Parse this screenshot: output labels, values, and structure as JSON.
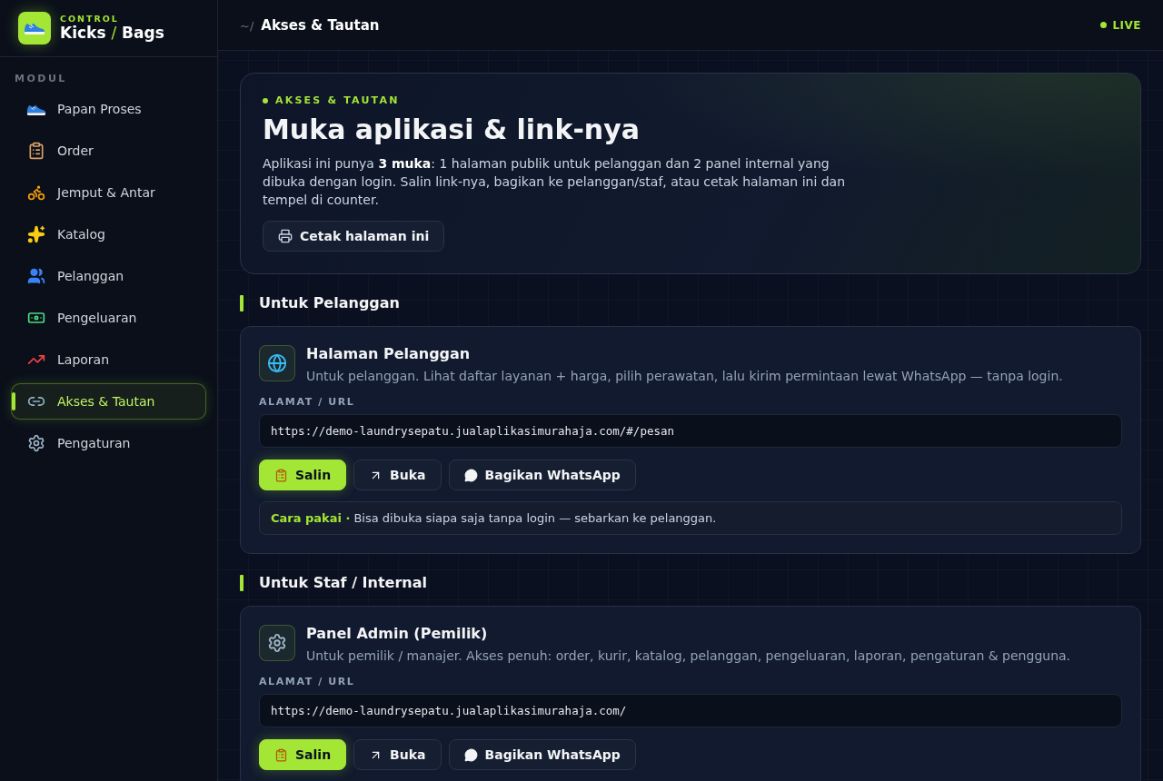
{
  "sidebar": {
    "brand": {
      "kicker": "CONTROL",
      "name_left": "Kicks",
      "name_separator": "/",
      "name_right": "Bags"
    },
    "section_label": "MODUL",
    "items": [
      {
        "label": "Papan Proses",
        "selected": false
      },
      {
        "label": "Order",
        "selected": false
      },
      {
        "label": "Jemput & Antar",
        "selected": false
      },
      {
        "label": "Katalog",
        "selected": false
      },
      {
        "label": "Pelanggan",
        "selected": false
      },
      {
        "label": "Pengeluaran",
        "selected": false
      },
      {
        "label": "Laporan",
        "selected": false
      },
      {
        "label": "Akses & Tautan",
        "selected": true
      },
      {
        "label": "Pengaturan",
        "selected": false
      }
    ]
  },
  "topbar": {
    "path_prefix": "~/",
    "title": "Akses & Tautan",
    "status": "LIVE"
  },
  "hero": {
    "eyebrow": "AKSES & TAUTAN",
    "title": "Muka aplikasi & link-nya",
    "description": "Aplikasi ini punya **3 muka**: 1 halaman publik untuk pelanggan dan 2 panel internal yang dibuka dengan login. Salin link-nya, bagikan ke pelanggan/staf, atau cetak halaman ini dan tempel di counter.",
    "print_button": "Cetak halaman ini"
  },
  "sections": [
    {
      "heading": "Untuk Pelanggan",
      "cards": [
        {
          "title": "Halaman Pelanggan",
          "description": "Untuk pelanggan. Lihat daftar layanan + harga, pilih perawatan, lalu kirim permintaan lewat WhatsApp — tanpa login.",
          "url_label": "ALAMAT / URL",
          "url": "https://demo-laundrysepatu.jualaplikasimurahaja.com/#/pesan",
          "buttons": [
            {
              "kind": "copy",
              "label": "Salin"
            },
            {
              "kind": "open",
              "label": "Buka"
            },
            {
              "kind": "share",
              "label": "Bagikan WhatsApp"
            }
          ],
          "note": "**Cara pakai ·** Bisa dibuka siapa saja tanpa login — sebarkan ke pelanggan."
        }
      ]
    },
    {
      "heading": "Untuk Staf / Internal",
      "cards": [
        {
          "title": "Panel Admin (Pemilik)",
          "description": "Untuk pemilik / manajer. Akses penuh: order, kurir, katalog, pelanggan, pengeluaran, laporan, pengaturan & pengguna.",
          "url_label": "ALAMAT / URL",
          "url": "https://demo-laundrysepatu.jualaplikasimurahaja.com/",
          "buttons": [
            {
              "kind": "copy",
              "label": "Salin"
            },
            {
              "kind": "open",
              "label": "Buka"
            },
            {
              "kind": "share",
              "label": "Bagikan WhatsApp"
            }
          ]
        }
      ]
    }
  ]
}
